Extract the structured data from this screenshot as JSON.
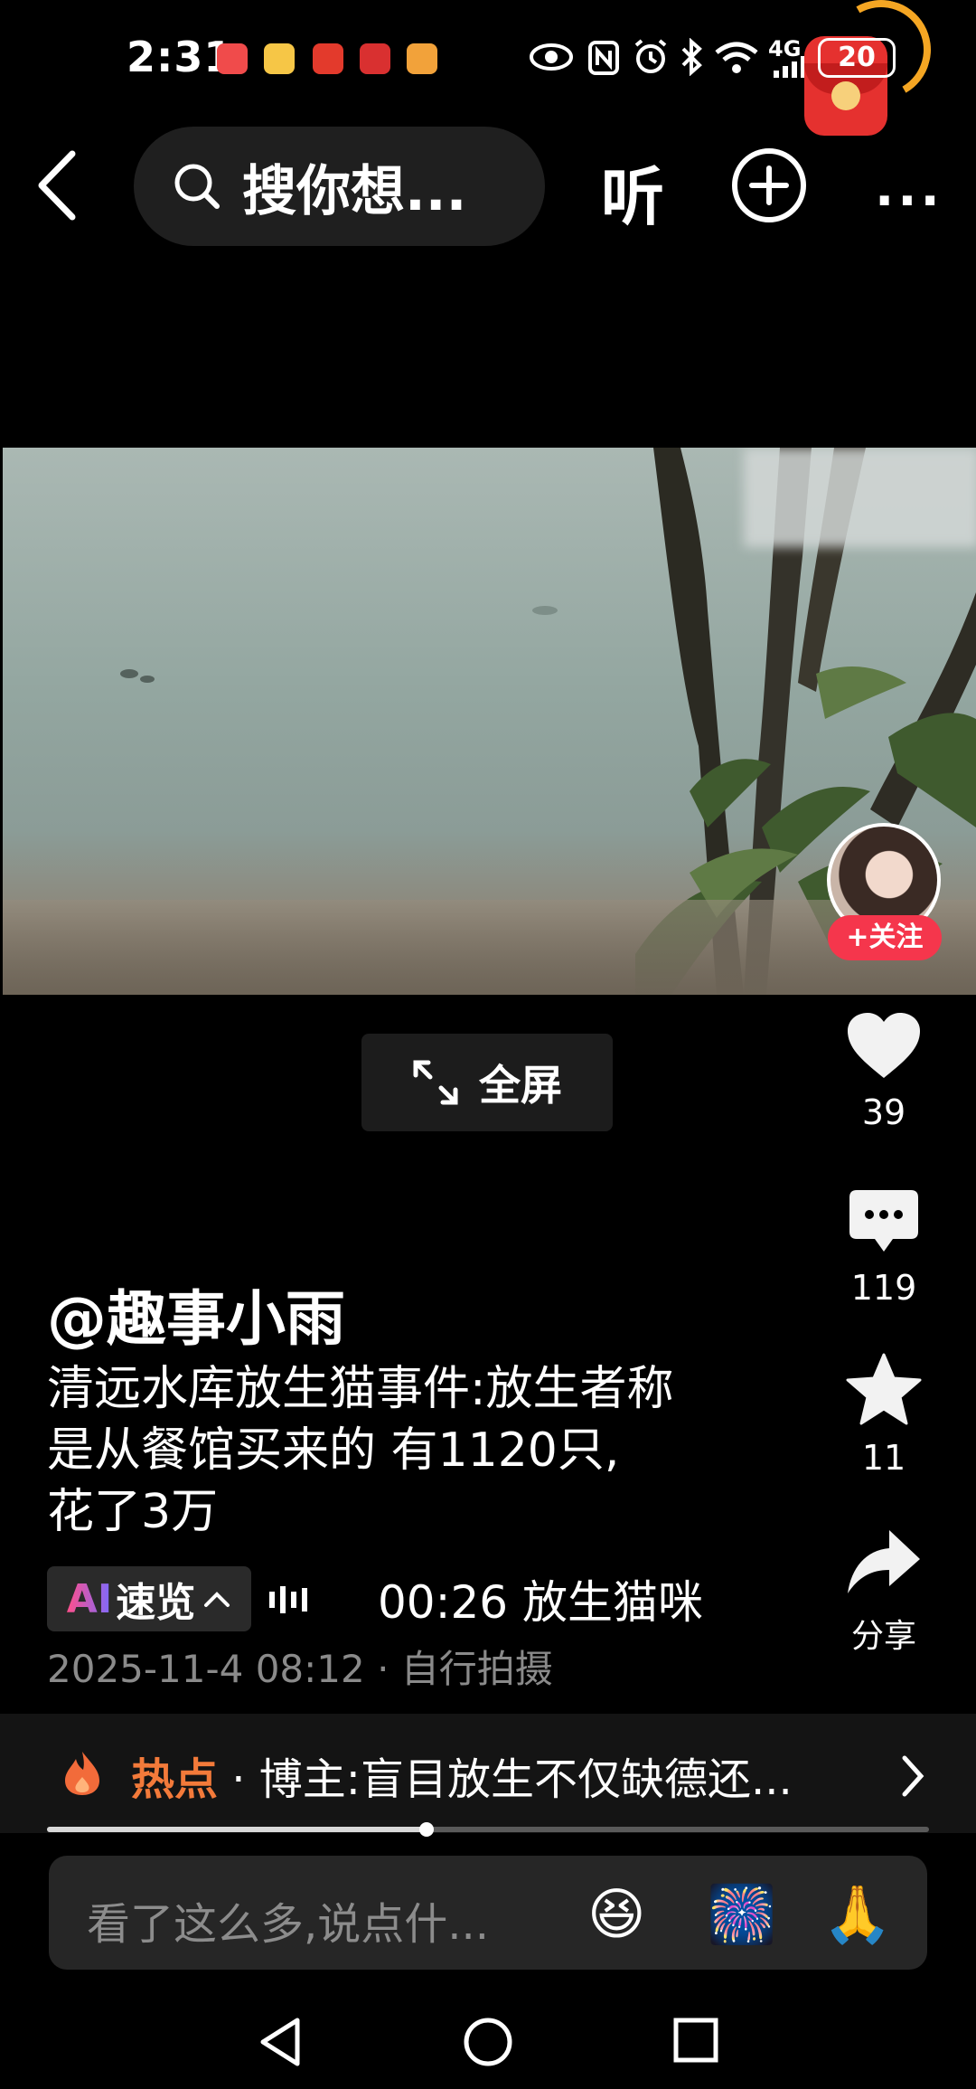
{
  "status_bar": {
    "time": "2:31",
    "network": "4G",
    "battery": "20"
  },
  "top_nav": {
    "search_placeholder": "搜你想...",
    "listen_label": "听",
    "more_label": "···"
  },
  "actions": {
    "follow_label": "+关注",
    "like_count": "39",
    "comment_count": "119",
    "favorite_count": "11",
    "share_label": "分享"
  },
  "fullscreen_label": "全屏",
  "post": {
    "author": "@趣事小雨",
    "description_lines": [
      "清远水库放生猫事件:放生者称",
      "是从餐馆买来的 有1120只,",
      "花了3万"
    ],
    "ai_summary_label": "速览",
    "ai_prefix": "AI",
    "music": "00:26 放生猫咪",
    "timestamp": "2025-11-4 08:12 · 自行拍摄"
  },
  "hot_topic": {
    "label": "热点",
    "text": " · 博主:盲目放生不仅缺德还..."
  },
  "playback": {
    "progress": 0.43
  },
  "comment": {
    "placeholder": "看了这么多,说点什...",
    "emojis": [
      "😆",
      "🎆",
      "🙏"
    ]
  },
  "colors": {
    "accent": "#f5364c",
    "hot": "#f37a3a"
  }
}
